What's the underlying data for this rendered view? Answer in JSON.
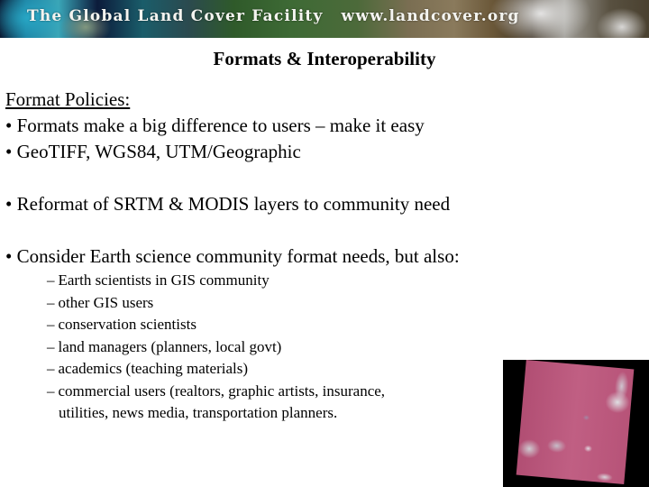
{
  "banner": {
    "organization": "The Global Land Cover Facility",
    "url": "www.landcover.org"
  },
  "slide": {
    "title": "Formats & Interoperability",
    "heading": "Format Policies:",
    "bullet_char": "•",
    "dash_char": "–",
    "bullets": [
      {
        "text": "Formats make a big difference to users – make it easy"
      },
      {
        "text": "GeoTIFF, WGS84, UTM/Geographic"
      },
      {
        "text": "Reformat of SRTM & MODIS layers to community need"
      },
      {
        "text": "Consider Earth science community format needs, but also:"
      }
    ],
    "subitems": [
      {
        "text": "Earth scientists in GIS community"
      },
      {
        "text": "other GIS users"
      },
      {
        "text": "conservation scientists"
      },
      {
        "text": "land managers (planners, local govt)"
      },
      {
        "text": "academics (teaching materials)"
      },
      {
        "text": "commercial users (realtors, graphic artists, insurance,"
      }
    ],
    "subitem_continuation": "utilities, news media, transportation planners."
  },
  "image": {
    "description": "satellite-scene-thumbnail"
  }
}
